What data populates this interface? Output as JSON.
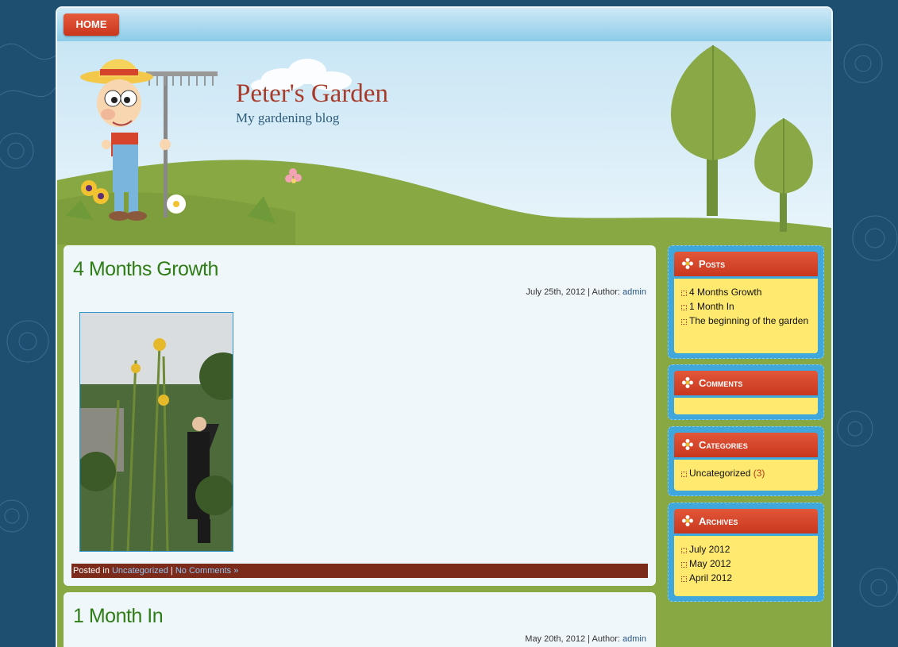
{
  "nav": {
    "home": "HOME"
  },
  "site": {
    "title": "Peter's Garden",
    "description": "My gardening blog"
  },
  "posts": [
    {
      "title": "4 Months Growth",
      "date": "July 25th, 2012",
      "author_label": "Author:",
      "author": "admin",
      "posted_in_label": "Posted in",
      "category": "Uncategorized",
      "comments": "No Comments »"
    },
    {
      "title": "1 Month In",
      "date": "May 20th, 2012",
      "author_label": "Author:",
      "author": "admin"
    }
  ],
  "sidebar": {
    "posts": {
      "title": "Posts",
      "items": [
        "4 Months Growth",
        "1 Month In",
        "The beginning of the garden"
      ]
    },
    "comments": {
      "title": "Comments"
    },
    "categories": {
      "title": "Categories",
      "items": [
        {
          "name": "Uncategorized",
          "count": "(3)"
        }
      ]
    },
    "archives": {
      "title": "Archives",
      "items": [
        "July 2012",
        "May 2012",
        "April 2012"
      ]
    }
  },
  "colors": {
    "page_bg": "#1f4f70",
    "header_sky": "#c9e6f5",
    "hill_green": "#88a844",
    "title_red": "#a83a2a",
    "post_title_green": "#2f7d16",
    "widget_blue": "#3fa7dc",
    "widget_yellow": "#ffe96e",
    "widget_header_red": "#d5432a",
    "post_footer_maroon": "#7c2a1a"
  }
}
